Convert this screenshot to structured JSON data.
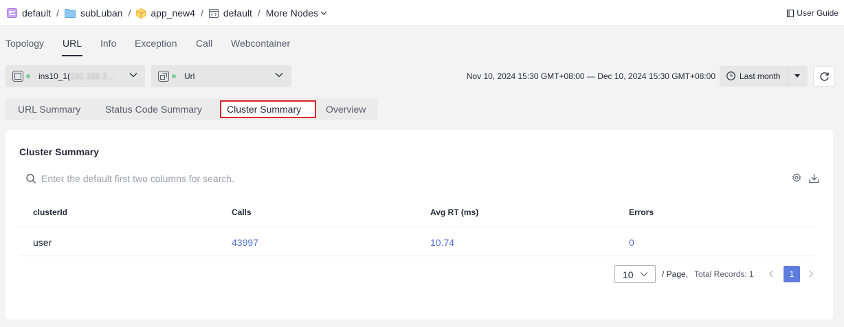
{
  "breadcrumb": {
    "items": [
      {
        "label": "default",
        "icon": "app-window-icon",
        "color": "#a97be0"
      },
      {
        "label": "subLuban",
        "icon": "folder-icon",
        "color": "#5aa9e6"
      },
      {
        "label": "app_new4",
        "icon": "cube-icon",
        "color": "#f3c343"
      },
      {
        "label": "default",
        "icon": "code-window-icon",
        "color": "#575d6c"
      }
    ],
    "separator": "/",
    "more_nodes": "More Nodes"
  },
  "user_guide": {
    "label": "User Guide",
    "icon": "book-icon"
  },
  "main_tabs": [
    {
      "label": "Topology",
      "active": false
    },
    {
      "label": "URL",
      "active": true
    },
    {
      "label": "Info",
      "active": false
    },
    {
      "label": "Exception",
      "active": false
    },
    {
      "label": "Call",
      "active": false
    },
    {
      "label": "Webcontainer",
      "active": false
    }
  ],
  "instance_select": {
    "value": "ins10_1(",
    "masked": "192.168.2...",
    "status_color": "#7ad1a0",
    "icon": "instance-icon"
  },
  "type_select": {
    "value": "Url",
    "status_color": "#7ad1a0",
    "icon": "url-icon"
  },
  "time": {
    "range": "Nov 10, 2024 15:30 GMT+08:00 — Dec 10, 2024 15:30 GMT+08:00",
    "period": "Last month"
  },
  "sub_tabs": [
    {
      "label": "URL Summary",
      "active": false
    },
    {
      "label": "Status Code Summary",
      "active": false
    },
    {
      "label": "Cluster Summary",
      "active": true
    },
    {
      "label": "Overview",
      "active": false
    }
  ],
  "card": {
    "title": "Cluster Summary",
    "search_placeholder": "Enter the default first two columns for search.",
    "table": {
      "columns": [
        "clusterId",
        "Calls",
        "Avg RT (ms)",
        "Errors"
      ],
      "rows": [
        {
          "clusterId": "user",
          "calls": "43997",
          "avg_rt": "10.74",
          "errors": "0"
        }
      ]
    },
    "pagination": {
      "page_size": "10",
      "per_page_label": "/ Page,",
      "total_label": "Total Records: 1",
      "current_page": "1"
    }
  },
  "colors": {
    "accent": "#5e7ce0",
    "link": "#526ecc",
    "highlight_border": "#d9262c"
  }
}
